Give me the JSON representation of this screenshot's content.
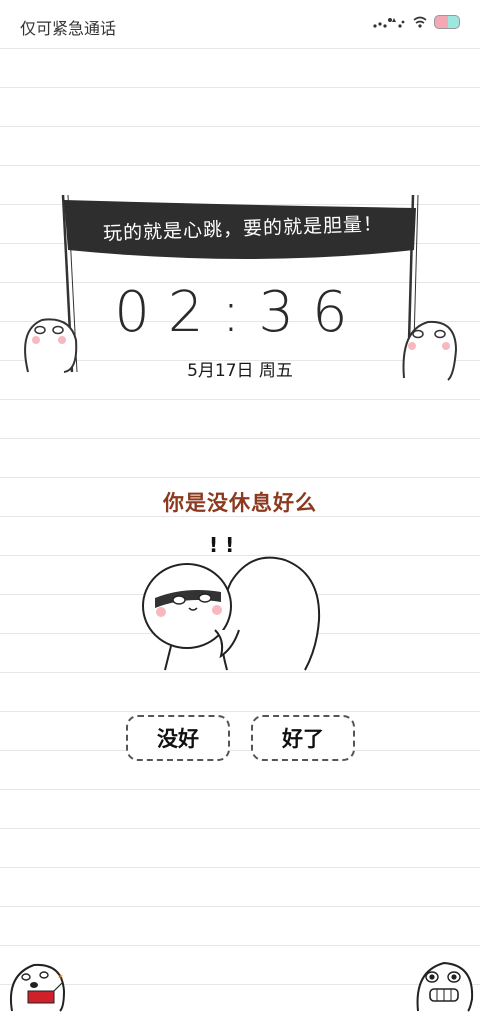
{
  "status_bar": {
    "carrier": "仅可紧急通话"
  },
  "banner": {
    "text": "玩的就是心跳，要的就是胆量！"
  },
  "lock_screen": {
    "time": "02:36",
    "date": "5月17日 周五"
  },
  "prompt": {
    "question": "你是没休息好么",
    "no_label": "没好",
    "yes_label": "好了"
  },
  "colors": {
    "question": "#8b3a1f",
    "banner": "#2e2e2e",
    "battery_pink": "#f4a7b5",
    "battery_teal": "#9ee6e0"
  },
  "icons": [
    "signal-dots-icon",
    "wifi-icon",
    "battery-icon",
    "firecracker-character",
    "grinning-character"
  ]
}
